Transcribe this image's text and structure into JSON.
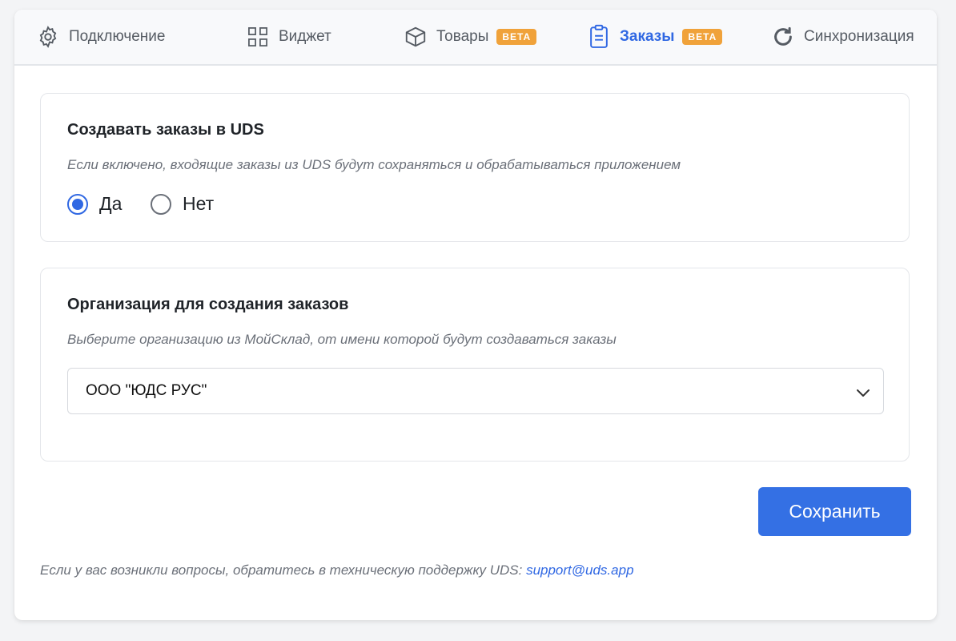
{
  "tabs": [
    {
      "label": "Подключение",
      "icon": "gear-icon"
    },
    {
      "label": "Виджет",
      "icon": "grid-icon"
    },
    {
      "label": "Товары",
      "icon": "box-icon",
      "badge": "BETA"
    },
    {
      "label": "Заказы",
      "icon": "clipboard-icon",
      "badge": "BETA",
      "active": true
    },
    {
      "label": "Синхронизация",
      "icon": "refresh-icon"
    }
  ],
  "create_orders": {
    "title": "Создавать заказы в UDS",
    "description": "Если включено, входящие заказы из UDS будут сохраняться и обрабатываться приложением",
    "options": [
      "Да",
      "Нет"
    ],
    "selected": "Да"
  },
  "organization": {
    "title": "Организация для создания заказов",
    "description": "Выберите организацию из МойСклад, от имени которой будут создаваться заказы",
    "selected_value": "ООО \"ЮДС РУС\""
  },
  "save_label": "Сохранить",
  "footer": {
    "text": "Если у вас возникли вопросы, обратитесь в техническую поддержку UDS: ",
    "email": "support@uds.app"
  },
  "colors": {
    "accent": "#3068e3",
    "badge": "#f0a23a",
    "button": "#3470e4"
  }
}
